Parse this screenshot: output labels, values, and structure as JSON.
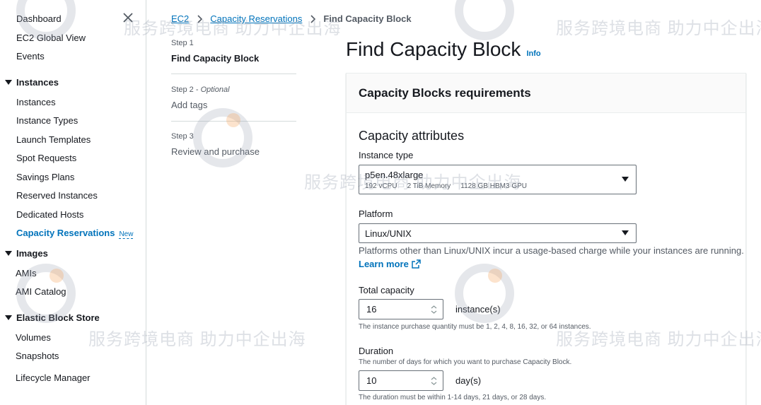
{
  "sidebar": {
    "items_top": [
      {
        "label": "Dashboard"
      },
      {
        "label": "EC2 Global View"
      },
      {
        "label": "Events"
      }
    ],
    "sections": [
      {
        "title": "Instances",
        "items": [
          "Instances",
          "Instance Types",
          "Launch Templates",
          "Spot Requests",
          "Savings Plans",
          "Reserved Instances",
          "Dedicated Hosts"
        ]
      },
      {
        "title": "Images",
        "items": [
          "AMIs",
          "AMI Catalog"
        ]
      },
      {
        "title": "Elastic Block Store",
        "items": [
          "Volumes",
          "Snapshots",
          "Lifecycle Manager"
        ]
      }
    ],
    "active_item": {
      "label": "Capacity Reservations",
      "badge": "New"
    }
  },
  "breadcrumb": {
    "items": [
      "EC2",
      "Capacity Reservations"
    ],
    "current": "Find Capacity Block"
  },
  "steps": [
    {
      "label": "Step 1",
      "optional": "",
      "title": "Find Capacity Block",
      "active": true
    },
    {
      "label": "Step 2 - ",
      "optional": "Optional",
      "title": "Add tags",
      "active": false
    },
    {
      "label": "Step 3",
      "optional": "",
      "title": "Review and purchase",
      "active": false
    }
  ],
  "page": {
    "title": "Find Capacity Block",
    "info": "Info"
  },
  "panel": {
    "header": "Capacity Blocks requirements",
    "section_title": "Capacity attributes",
    "instance_type": {
      "label": "Instance type",
      "value": "p5en.48xlarge",
      "specs": [
        "192 vCPU",
        "2 TiB Memory",
        "1128 GB HBM3 GPU"
      ]
    },
    "platform": {
      "label": "Platform",
      "value": "Linux/UNIX",
      "description": "Platforms other than Linux/UNIX incur a usage-based charge while your instances are running.",
      "learn_more": "Learn more"
    },
    "total_capacity": {
      "label": "Total capacity",
      "value": "16",
      "unit": "instance(s)",
      "hint": "The instance purchase quantity must be 1, 2, 4, 8, 16, 32, or 64 instances."
    },
    "duration": {
      "label": "Duration",
      "description": "The number of days for which you want to purchase Capacity Block.",
      "value": "10",
      "unit": "day(s)",
      "hint": "The duration must be within 1-14 days, 21 days, or 28 days."
    }
  },
  "watermark": {
    "text": "服务跨境电商 助力中企出海",
    "color": "#9aa4b2",
    "logo_color": "#f5a25a"
  },
  "colors": {
    "link": "#0073bb",
    "text": "#16191f",
    "secondary": "#545b64"
  }
}
